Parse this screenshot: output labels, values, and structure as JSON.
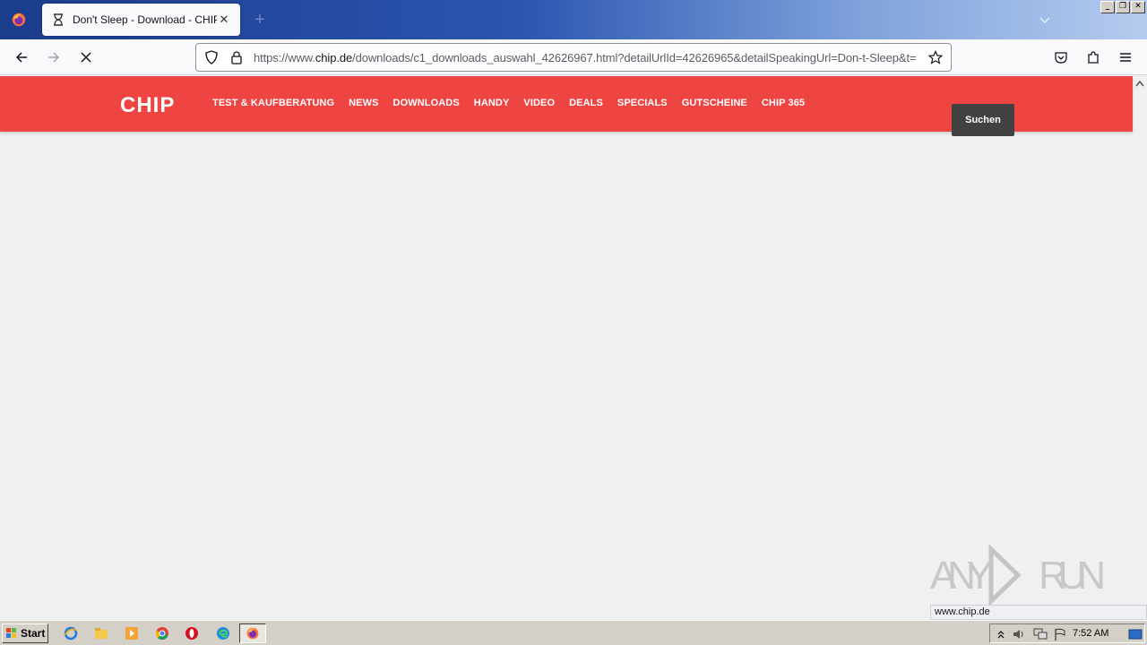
{
  "browser": {
    "tab": {
      "title": "Don't Sleep - Download - CHIP"
    },
    "url": {
      "scheme": "https://www.",
      "host": "chip.de",
      "path": "/downloads/c1_downloads_auswahl_42626967.html?detailUrlId=42626965&detailSpeakingUrl=Don-t-Sleep&t="
    }
  },
  "chip": {
    "logo": "CHIP",
    "nav": [
      "TEST & KAUFBERATUNG",
      "NEWS",
      "DOWNLOADS",
      "HANDY",
      "VIDEO",
      "DEALS",
      "SPECIALS",
      "GUTSCHEINE",
      "CHIP 365"
    ],
    "search_label": "Suchen",
    "brand_color": "#ee4542"
  },
  "watermark": "ANY RUN",
  "status_bar": "www.chip.de",
  "taskbar": {
    "start_label": "Start",
    "clock": "7:52 AM"
  }
}
